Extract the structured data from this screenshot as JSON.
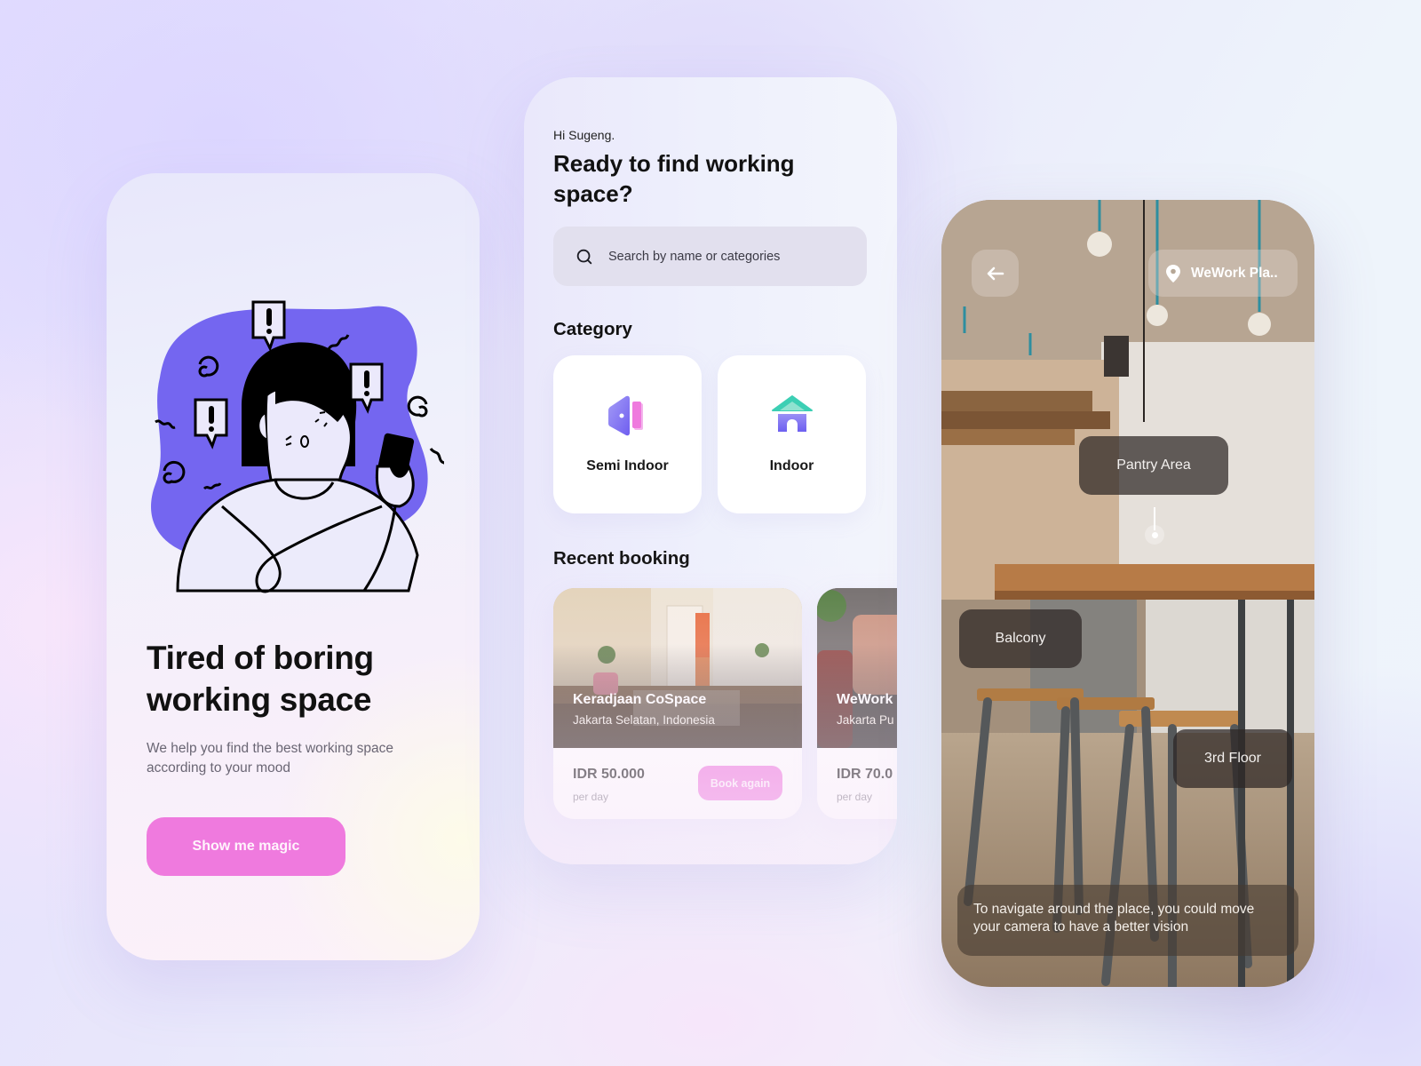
{
  "onboarding": {
    "title": "Tired of boring working space",
    "subtitle": "We help you find the best working space according to your mood",
    "cta_label": "Show me magic",
    "illustration": "stressed-person-with-phone-illustration"
  },
  "home": {
    "greeting": "Hi Sugeng.",
    "title": "Ready to find working space?",
    "search": {
      "placeholder": "Search by name or categories",
      "value": "",
      "icon": "search-icon"
    },
    "category_title": "Category",
    "categories": [
      {
        "label": "Semi Indoor",
        "icon": "door-icon"
      },
      {
        "label": "Indoor",
        "icon": "house-icon"
      }
    ],
    "recent_title": "Recent booking",
    "bookings": [
      {
        "name": "Keradjaan CoSpace",
        "location": "Jakarta Selatan, Indonesia",
        "price": "IDR 50.000",
        "unit": "per day",
        "action": "Book again"
      },
      {
        "name": "WeWork",
        "location": "Jakarta Pu",
        "price": "IDR 70.0",
        "unit": "per day"
      }
    ]
  },
  "ar_view": {
    "back_icon": "arrow-left-icon",
    "location_icon": "map-pin-icon",
    "location_label": "WeWork Pla..",
    "tags": [
      {
        "label": "Pantry Area"
      },
      {
        "label": "Balcony"
      },
      {
        "label": "3rd Floor"
      }
    ],
    "hint": "To navigate around the place, you could move your camera to have a better vision"
  },
  "colors": {
    "accent_pink": "#ef7ade",
    "illustration_purple": "#7466f0",
    "category_teal": "#3ccfb4"
  }
}
